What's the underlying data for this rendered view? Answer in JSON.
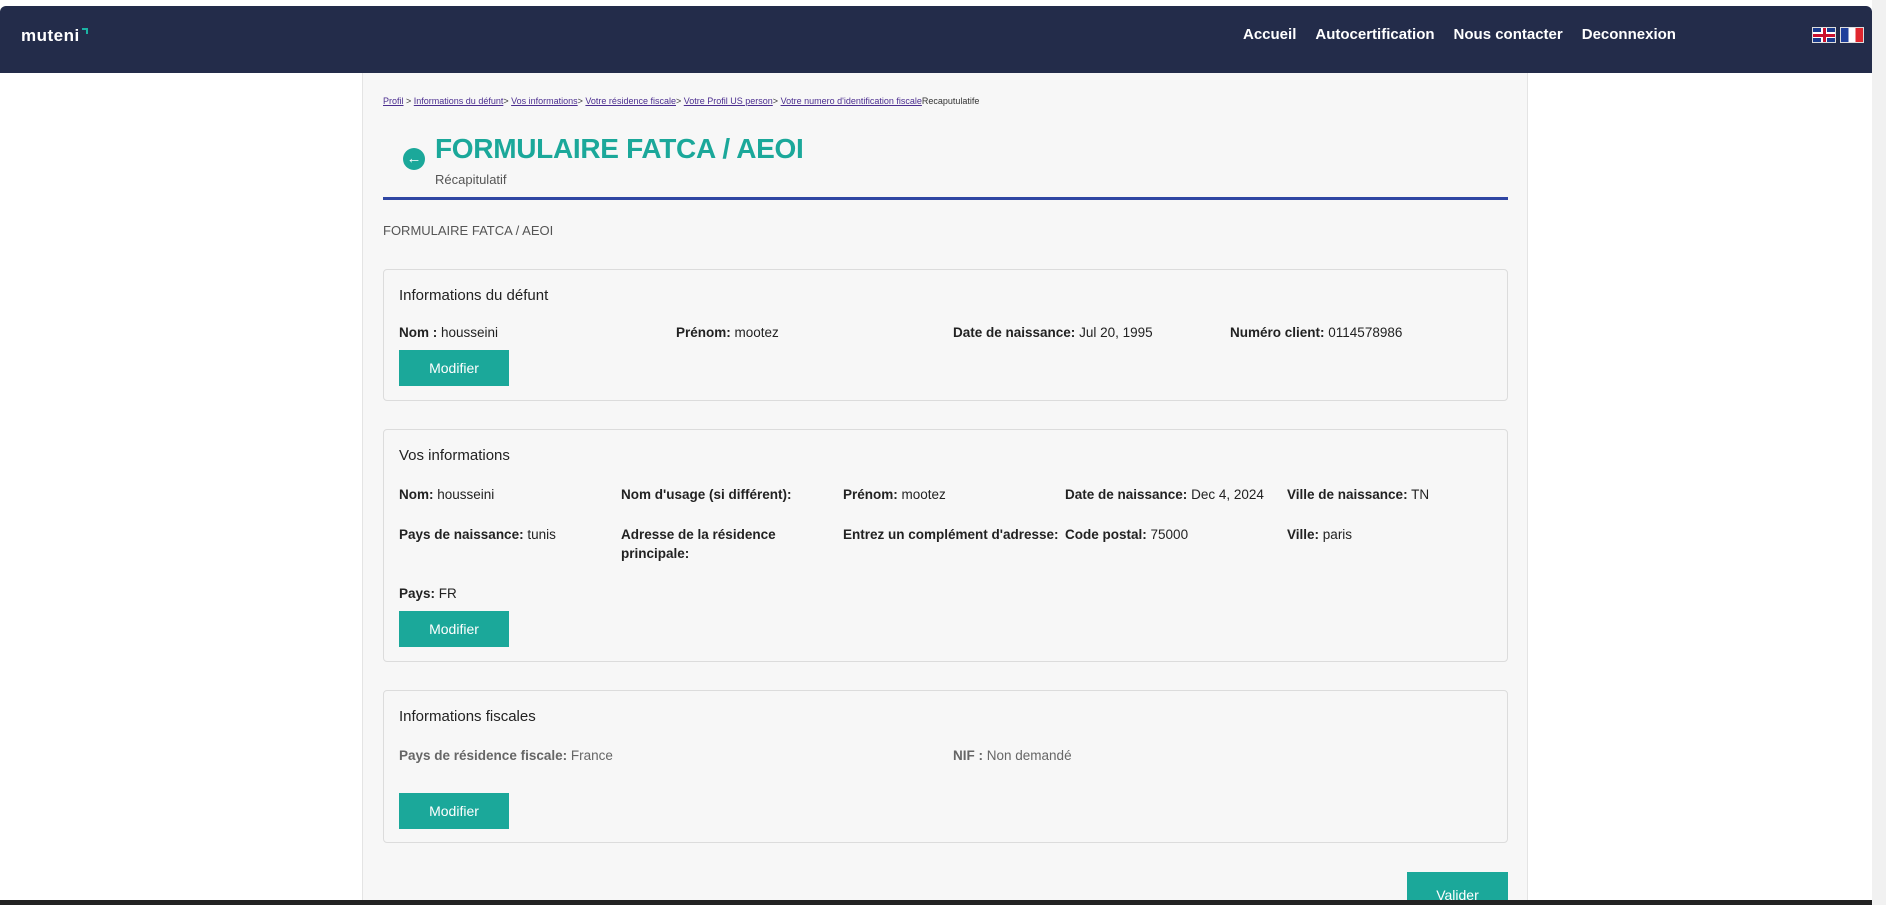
{
  "header": {
    "logo": "muteni",
    "nav": [
      "Accueil",
      "Autocertification",
      "Nous contacter",
      "Deconnexion"
    ]
  },
  "breadcrumb": {
    "items": [
      "Profil",
      "Informations du défunt",
      "Vos informations",
      "Votre résidence fiscale",
      "Votre Profil US person",
      "Votre numero d'identification fiscale"
    ],
    "current": "Recaputulatife"
  },
  "page": {
    "title": "FORMULAIRE FATCA / AEOI",
    "subtitle": "Récapitulatif",
    "section_label": "FORMULAIRE FATCA / AEOI"
  },
  "defunt": {
    "title": "Informations du défunt",
    "nom_label": "Nom :",
    "nom": "housseini",
    "prenom_label": "Prénom:",
    "prenom": "mootez",
    "naissance_label": "Date de naissance:",
    "naissance": "Jul 20, 1995",
    "client_label": "Numéro client:",
    "client": "0114578986",
    "button": "Modifier"
  },
  "vous": {
    "title": "Vos informations",
    "nom_label": "Nom:",
    "nom": "housseini",
    "usage_label": "Nom d'usage (si différent):",
    "usage": "",
    "prenom_label": "Prénom:",
    "prenom": "mootez",
    "naissance_label": "Date de naissance:",
    "naissance": "Dec 4, 2024",
    "ville_naissance_label": "Ville de naissance:",
    "ville_naissance": "TN",
    "pays_naissance_label": "Pays de naissance:",
    "pays_naissance": "tunis",
    "adresse_label": "Adresse de la résidence principale:",
    "adresse": "",
    "complement_label": "Entrez un complément d'adresse:",
    "complement": "",
    "cp_label": "Code postal:",
    "cp": "75000",
    "ville_label": "Ville:",
    "ville": "paris",
    "pays_label": "Pays:",
    "pays": "FR",
    "button": "Modifier"
  },
  "fiscal": {
    "title": "Informations fiscales",
    "pays_label": "Pays de résidence fiscale:",
    "pays": "France",
    "nif_label": "NIF :",
    "nif": "Non demandé",
    "button": "Modifier"
  },
  "submit_label": "Valider",
  "colors": {
    "header": "#232c4a",
    "accent": "#1ba89a",
    "rule": "#2f46a3"
  },
  "icons": {
    "back": "arrow-left-icon",
    "flags": [
      "uk-flag-icon",
      "fr-flag-icon"
    ]
  }
}
